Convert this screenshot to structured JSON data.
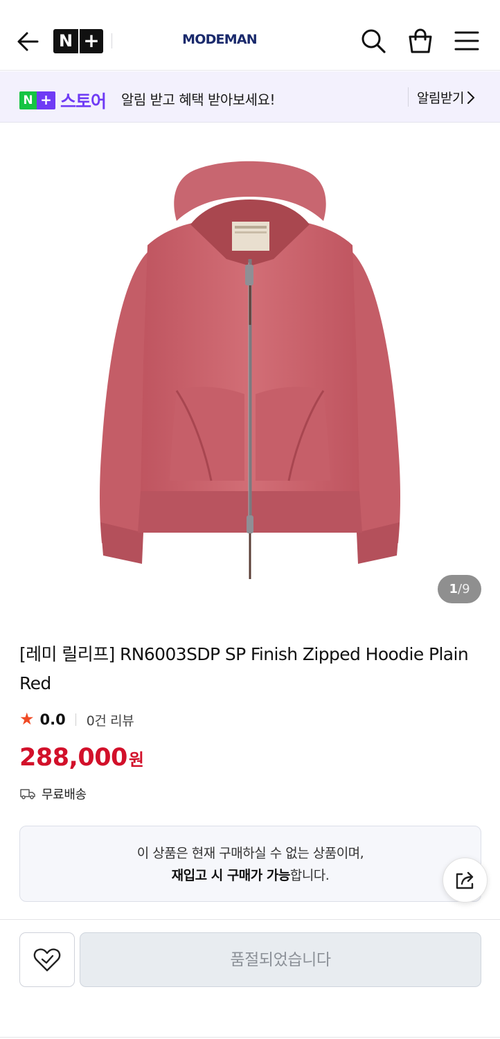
{
  "header": {
    "logo_n": "N",
    "logo_plus": "+",
    "brand": "MODEMAN"
  },
  "store_banner": {
    "logo_n": "N",
    "logo_plus": "+",
    "store_word": "스토어",
    "message": "알림 받고 혜택 받아보세요!",
    "notify_label": "알림받기"
  },
  "gallery": {
    "current": "1",
    "separator": "/",
    "total": "9"
  },
  "product": {
    "title": "[레미 릴리프] RN6003SDP SP Finish Zipped Hoodie Plain Red",
    "rating": "0.0",
    "review_count": "0건 리뷰",
    "price": "288,000",
    "currency": "원",
    "shipping": "무료배송"
  },
  "notice": {
    "line1": "이 상품은 현재 구매하실 수 없는 상품이며,",
    "line2_bold": "재입고 시 구매가 가능",
    "line2_rest": "합니다."
  },
  "actions": {
    "soldout_label": "품절되었습니다"
  },
  "colors": {
    "price": "#d2102a",
    "store_purple": "#6f3bf5",
    "store_green": "#15c442",
    "star": "#f04a25",
    "hoodie": "#c9616a"
  }
}
